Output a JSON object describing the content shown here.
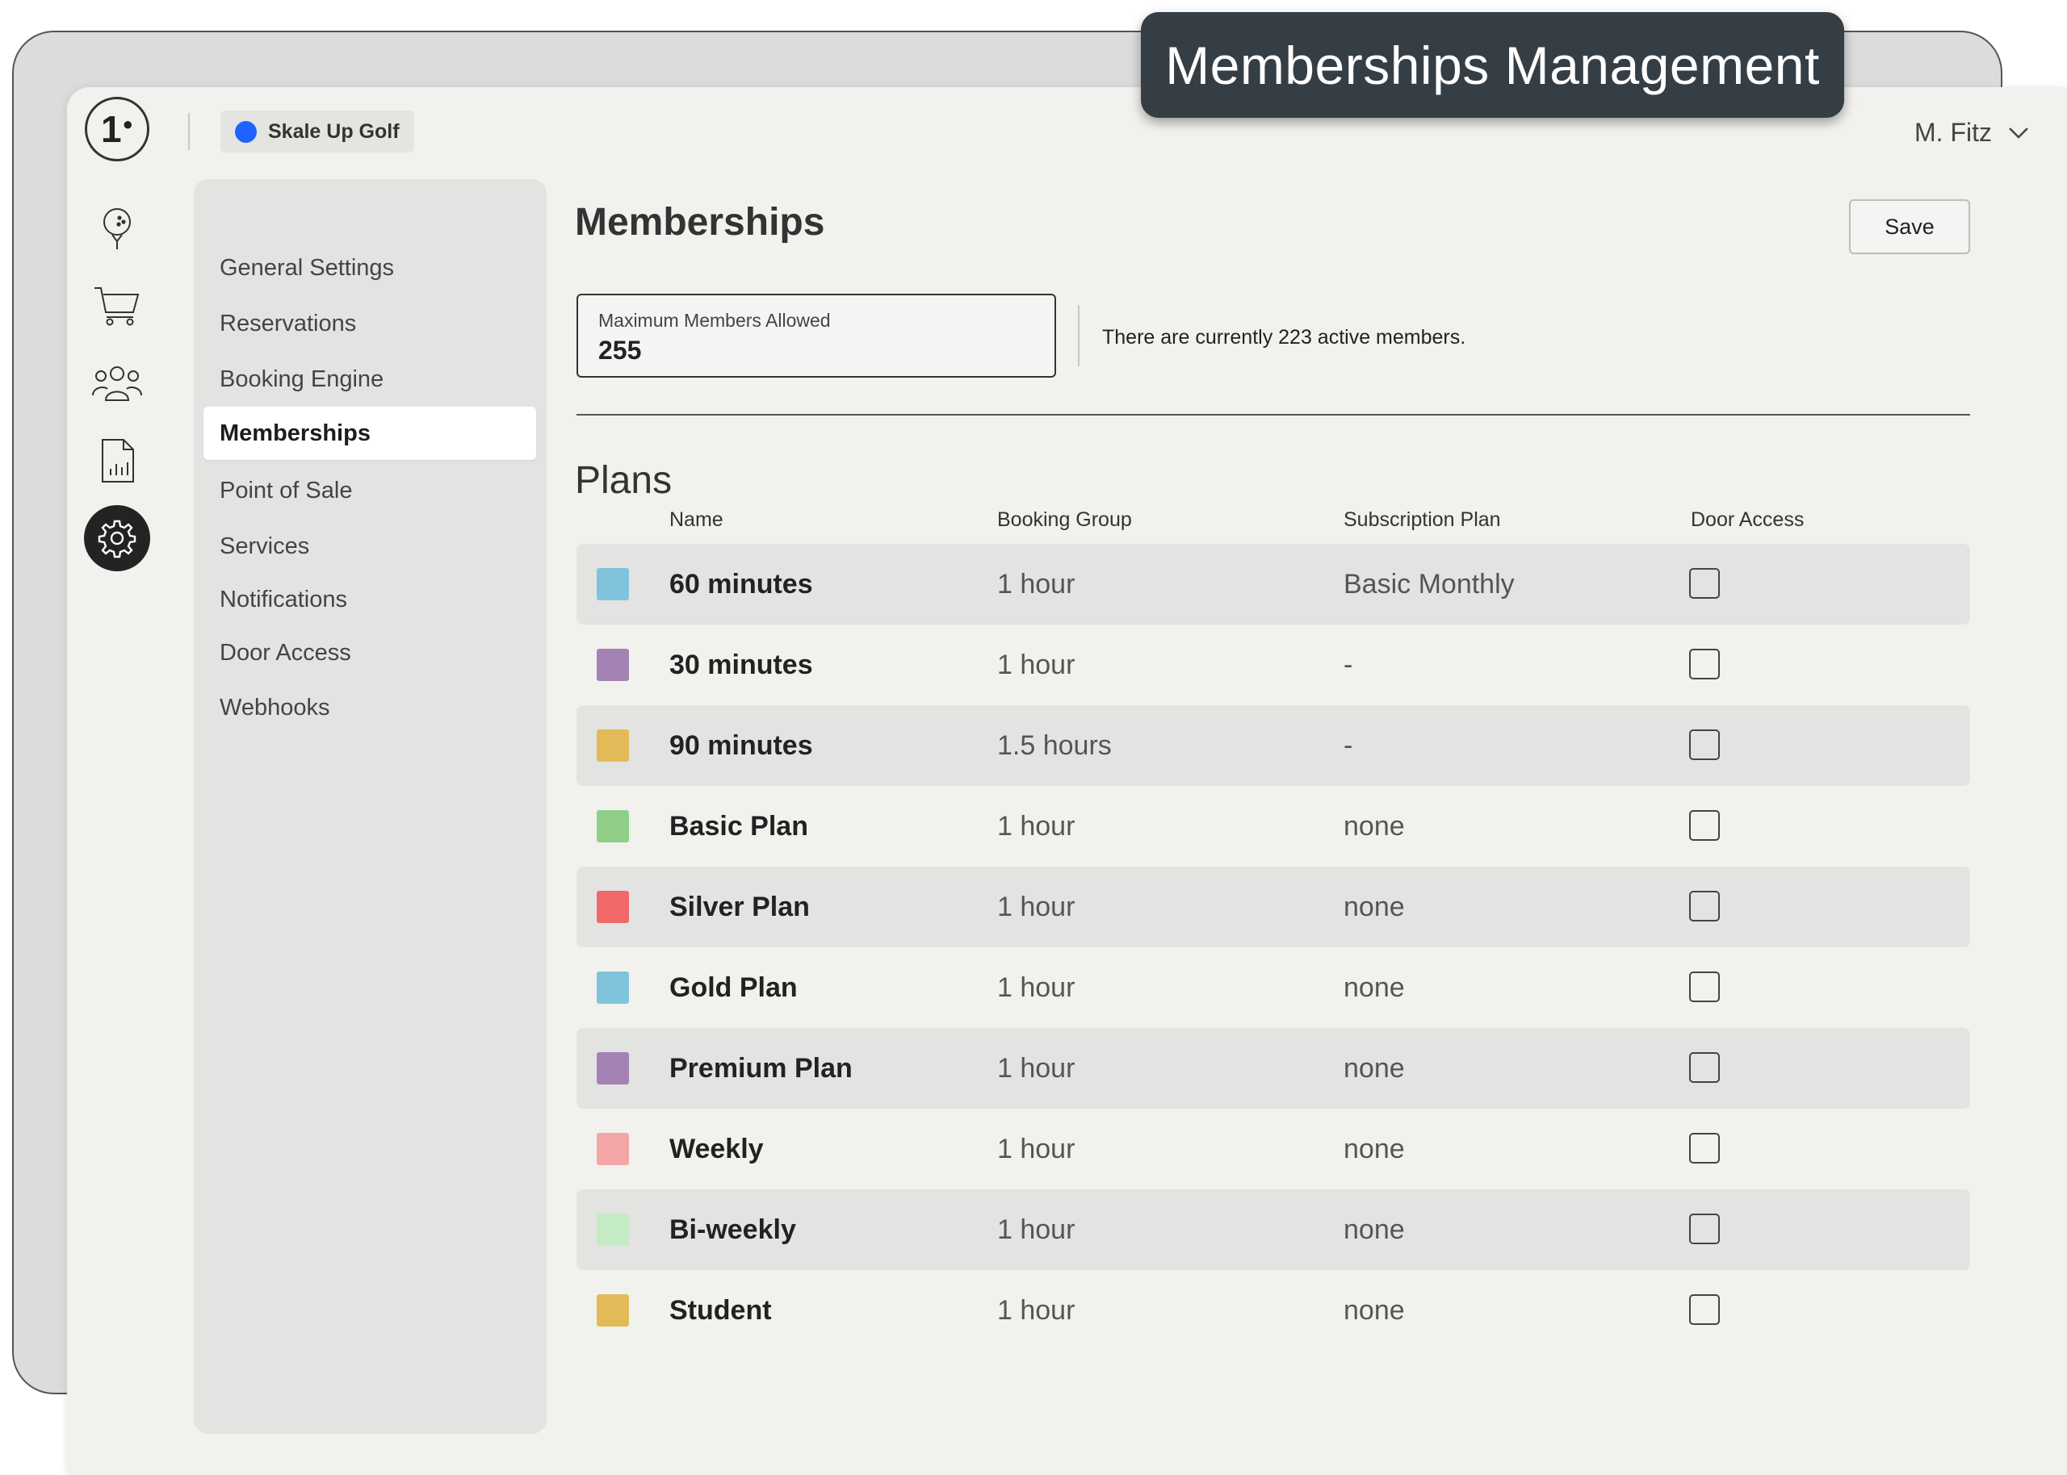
{
  "banner": {
    "title": "Memberships Management"
  },
  "header": {
    "logo_text": "1",
    "org_name": "Skale Up Golf",
    "org_dot_color": "#1e63ff",
    "user_name": "M. Fitz"
  },
  "rail": {
    "icons": [
      "golf-ball-icon",
      "cart-icon",
      "users-icon",
      "report-icon",
      "settings-icon"
    ],
    "active": "settings-icon"
  },
  "subnav": {
    "items": [
      {
        "label": "General Settings"
      },
      {
        "label": "Reservations"
      },
      {
        "label": "Booking Engine"
      },
      {
        "label": "Memberships",
        "active": true
      },
      {
        "label": "Point of Sale"
      },
      {
        "label": "Services"
      },
      {
        "label": "Notifications"
      },
      {
        "label": "Door Access"
      },
      {
        "label": "Webhooks"
      }
    ]
  },
  "main": {
    "title": "Memberships",
    "save_label": "Save",
    "max_members": {
      "label": "Maximum Members Allowed",
      "value": "255"
    },
    "active_text": "There are currently 223 active members.",
    "plans_title": "Plans",
    "columns": {
      "name": "Name",
      "booking_group": "Booking Group",
      "subscription_plan": "Subscription Plan",
      "door_access": "Door Access"
    },
    "plans": [
      {
        "name": "60 minutes",
        "color": "#7fc4dc",
        "booking_group": "1 hour",
        "subscription": "Basic Monthly",
        "door_access": false
      },
      {
        "name": "30 minutes",
        "color": "#a283b4",
        "booking_group": "1 hour",
        "subscription": "-",
        "door_access": false
      },
      {
        "name": "90 minutes",
        "color": "#e2bb58",
        "booking_group": "1.5 hours",
        "subscription": "-",
        "door_access": false
      },
      {
        "name": "Basic Plan",
        "color": "#8fcf88",
        "booking_group": "1 hour",
        "subscription": "none",
        "door_access": false
      },
      {
        "name": "Silver Plan",
        "color": "#f06868",
        "booking_group": "1 hour",
        "subscription": "none",
        "door_access": false
      },
      {
        "name": "Gold Plan",
        "color": "#7fc4dc",
        "booking_group": "1 hour",
        "subscription": "none",
        "door_access": false
      },
      {
        "name": "Premium Plan",
        "color": "#a283b4",
        "booking_group": "1 hour",
        "subscription": "none",
        "door_access": false
      },
      {
        "name": "Weekly",
        "color": "#f4a6a6",
        "booking_group": "1 hour",
        "subscription": "none",
        "door_access": false
      },
      {
        "name": "Bi-weekly",
        "color": "#c5ebc4",
        "booking_group": "1 hour",
        "subscription": "none",
        "door_access": false
      },
      {
        "name": "Student",
        "color": "#e2bb58",
        "booking_group": "1 hour",
        "subscription": "none",
        "door_access": false
      }
    ]
  }
}
